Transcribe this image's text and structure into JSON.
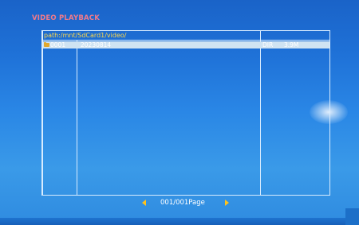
{
  "screen": {
    "title": "VIDEO PLAYBACK"
  },
  "browser": {
    "path": "path:/mnt/SdCard1/video/",
    "rows": [
      {
        "index": "0001",
        "name": "20230814",
        "type": "DIR",
        "size": "3.9M",
        "icon": "folder-icon",
        "selected": true
      }
    ]
  },
  "pager": {
    "label": "001/001Page",
    "prev_icon": "arrow-left-icon",
    "next_icon": "arrow-right-icon"
  },
  "colors": {
    "title": "#f07a8a",
    "path": "#ffd84a",
    "arrows": "#ffc21a",
    "grid": "#d8ecff",
    "selection": "#cfe3f2"
  }
}
